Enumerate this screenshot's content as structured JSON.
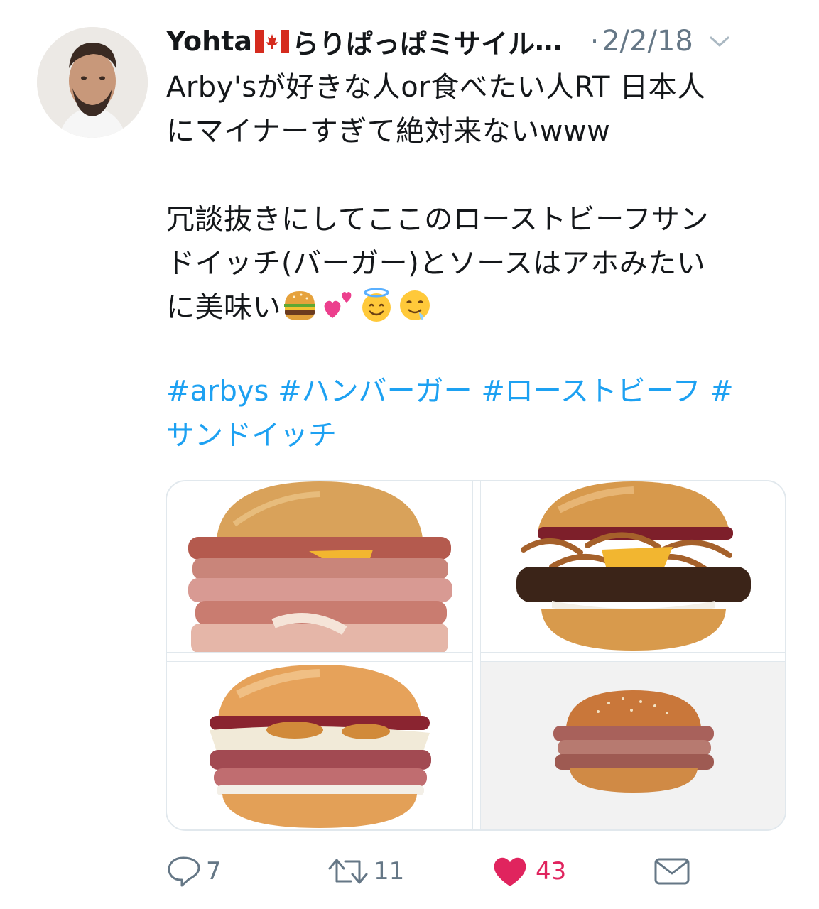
{
  "tweet": {
    "author": {
      "name_part1": "Yohta",
      "name_part2": "らりぱっぱミサイル",
      "ellipsis": "…"
    },
    "separator": "·",
    "date": "2/2/18",
    "text": {
      "line1": "Arby'sが好きな人or食べたい人RT 日本人",
      "line2": "にマイナーすぎて絶対来ないwww",
      "line3": "冗談抜きにしてここのローストビーフサン",
      "line4": "ドイッチ(バーガー)とソースはアホみたい",
      "line5": "に美味い"
    },
    "hashtags": {
      "tag1": "#arbys",
      "tag2": "#ハンバーガー",
      "tag3": "#ローストビーフ",
      "tag4_hash": "#",
      "tag4_word": "サンドイッチ"
    },
    "emoji": [
      "burger-emoji",
      "two-hearts-emoji",
      "halo-smile-emoji",
      "drooling-face-emoji"
    ],
    "media": [
      "stacked-meat-sandwich-photo",
      "onion-ring-steak-sandwich-photo",
      "smokehouse-sandwich-photo",
      "classic-roast-beef-photo"
    ],
    "actions": {
      "reply_count": "7",
      "retweet_count": "11",
      "like_count": "43"
    },
    "colors": {
      "link": "#1da1f2",
      "secondary": "#657786",
      "like": "#e0245e"
    }
  }
}
